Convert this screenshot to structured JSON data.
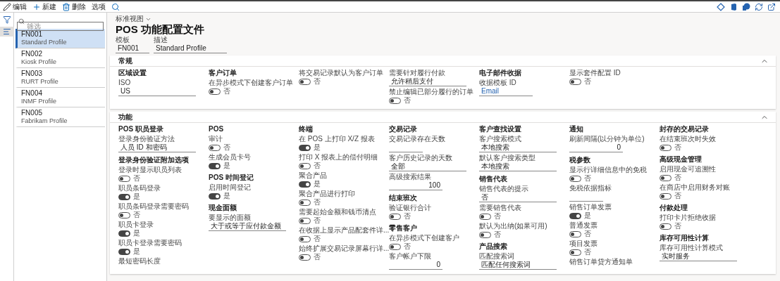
{
  "toolbar": {
    "actions": [
      {
        "label": "编辑",
        "kind": "edit"
      },
      {
        "label": "新建",
        "kind": "new"
      },
      {
        "label": "删除",
        "kind": "delete"
      },
      {
        "label": "选项",
        "kind": "plain"
      }
    ]
  },
  "filter": {
    "placeholder": "筛选"
  },
  "records": [
    {
      "id": "FN001",
      "name": "Standard Profile",
      "selected": true
    },
    {
      "id": "FN002",
      "name": "Kiosk Profile",
      "selected": false
    },
    {
      "id": "FN003",
      "name": "RURT Profile",
      "selected": false
    },
    {
      "id": "FN004",
      "name": "INMF Profile",
      "selected": false
    },
    {
      "id": "FN005",
      "name": "Fabrikam Profile",
      "selected": false
    }
  ],
  "view": {
    "label": "标准视图"
  },
  "title": "POS 功能配置文件",
  "header_fields": [
    {
      "label": "模板",
      "value": "FN001"
    },
    {
      "label": "描述",
      "value": "Standard Profile"
    }
  ],
  "sections": [
    {
      "title": "常规",
      "expanded": true,
      "columns": [
        [
          {
            "title": "区域设置",
            "fields": [
              {
                "kind": "text",
                "label": "ISO",
                "value": "US"
              }
            ]
          }
        ],
        [
          {
            "title": "客户订单",
            "fields": [
              {
                "kind": "toggle",
                "label": "在异步模式下创建客户订单",
                "on": false,
                "state_text": "否"
              }
            ]
          }
        ],
        [
          {
            "fields": [
              {
                "kind": "toggle",
                "label": "将交易记录默认为客户订单",
                "on": false,
                "state_text": "否"
              }
            ]
          }
        ],
        [
          {
            "fields": [
              {
                "kind": "text",
                "label": "需要针对履行付款",
                "value": "允许稍后支付"
              },
              {
                "kind": "toggle",
                "label": "禁止编辑已部分履行的订单",
                "on": false,
                "state_text": "否"
              }
            ]
          }
        ],
        [
          {
            "title": "电子邮件收据",
            "fields": [
              {
                "kind": "link",
                "label": "收据模板 ID",
                "value": "Email"
              }
            ]
          }
        ],
        [
          {
            "fields": [
              {
                "kind": "toggle",
                "label": "显示套件配置 ID",
                "on": false,
                "state_text": "否"
              }
            ]
          }
        ],
        []
      ]
    },
    {
      "title": "功能",
      "expanded": true,
      "columns": [
        [
          {
            "title": "POS 职员登录",
            "fields": [
              {
                "kind": "text",
                "label": "登录身份验证方法",
                "value": "人员 ID 和密码"
              }
            ]
          },
          {
            "title": "登录身份验证附加选项",
            "fields": [
              {
                "kind": "toggle",
                "label": "登录时显示职员列表",
                "on": false,
                "state_text": "否"
              },
              {
                "kind": "toggle",
                "label": "职员条码登录",
                "on": true,
                "state_text": "是"
              },
              {
                "kind": "toggle",
                "label": "职员条码登录需要密码",
                "on": false,
                "state_text": "否"
              },
              {
                "kind": "toggle",
                "label": "职员卡登录",
                "on": true,
                "state_text": "是"
              },
              {
                "kind": "toggle",
                "label": "职员卡登录需要密码",
                "on": true,
                "state_text": "是"
              },
              {
                "kind": "caption",
                "label": "最短密码长度"
              }
            ]
          }
        ],
        [
          {
            "title": "POS",
            "fields": [
              {
                "kind": "toggle",
                "label": "审计",
                "on": false,
                "state_text": "否"
              },
              {
                "kind": "toggle",
                "label": "生成会员卡号",
                "on": true,
                "state_text": "是"
              }
            ]
          },
          {
            "title": "POS 时间登记",
            "fields": [
              {
                "kind": "toggle",
                "label": "启用时间登记",
                "on": true,
                "state_text": "是"
              }
            ]
          },
          {
            "title": "现金面额",
            "fields": [
              {
                "kind": "text",
                "label": "要显示的面额",
                "value": "大于或等于应付款金额"
              }
            ]
          }
        ],
        [
          {
            "title": "终端",
            "fields": [
              {
                "kind": "toggle",
                "label": "在 POS 上打印 X/Z 报表",
                "on": true,
                "state_text": "是"
              },
              {
                "kind": "toggle",
                "label": "打印 X 报表上的偿付明细",
                "on": false,
                "state_text": "否"
              },
              {
                "kind": "toggle",
                "label": "聚合产品",
                "on": true,
                "state_text": "是"
              },
              {
                "kind": "toggle",
                "label": "聚合产品进行打印",
                "on": false,
                "state_text": "否"
              },
              {
                "kind": "toggle",
                "label": "需要起始金额和钱币清点",
                "on": false,
                "state_text": "否"
              },
              {
                "kind": "toggle",
                "label": "在收据上显示产品配套件详...",
                "on": false,
                "state_text": "否"
              },
              {
                "kind": "toggle",
                "label": "始终扩展交易记录屏幕行详...",
                "on": false,
                "state_text": "否"
              }
            ]
          }
        ],
        [
          {
            "title": "交易记录",
            "fields": [
              {
                "kind": "empty",
                "label": "交易记录存在天数"
              },
              {
                "kind": "text",
                "label": "客户历史记录的天数",
                "value": "全部"
              },
              {
                "kind": "number",
                "label": "高级搜索结果",
                "value": "100"
              }
            ]
          },
          {
            "title": "结束班次",
            "fields": [
              {
                "kind": "toggle",
                "label": "验证银行合计",
                "on": false,
                "state_text": "否"
              }
            ]
          },
          {
            "title": "零售客户",
            "fields": [
              {
                "kind": "toggle",
                "label": "在异步模式下创建客户",
                "on": false,
                "state_text": "否"
              },
              {
                "kind": "number",
                "label": "客户帐户下限",
                "value": "0"
              }
            ]
          }
        ],
        [
          {
            "title": "客户查找设置",
            "fields": [
              {
                "kind": "text",
                "label": "客户搜索模式",
                "value": "本地搜索"
              },
              {
                "kind": "text",
                "label": "默认客户搜索类型",
                "value": "本地搜索"
              }
            ]
          },
          {
            "title": "销售代表",
            "fields": [
              {
                "kind": "text",
                "label": "销售代表的提示",
                "value": "否"
              },
              {
                "kind": "toggle",
                "label": "需要销售代表",
                "on": false,
                "state_text": "否"
              },
              {
                "kind": "toggle",
                "label": "默认为出纳(如果可用)",
                "on": false,
                "state_text": "否"
              }
            ]
          },
          {
            "title": "产品搜索",
            "fields": [
              {
                "kind": "text",
                "label": "匹配搜索词",
                "value": "匹配任何搜索词"
              }
            ]
          }
        ],
        [
          {
            "title": "通知",
            "fields": [
              {
                "kind": "number",
                "label": "刷新间隔(以分钟为单位)",
                "value": "0"
              }
            ]
          },
          {
            "title": "税参数",
            "fields": [
              {
                "kind": "toggle",
                "label": "显示行详细信息中的免税",
                "on": false,
                "state_text": "否"
              },
              {
                "kind": "empty",
                "label": "免税依据指标"
              },
              {
                "kind": "toggle",
                "label": "销售订单发票",
                "on": true,
                "state_text": "是"
              },
              {
                "kind": "toggle",
                "label": "普通发票",
                "on": false,
                "state_text": "否"
              },
              {
                "kind": "toggle",
                "label": "项目发票",
                "on": false,
                "state_text": "否"
              },
              {
                "kind": "caption",
                "label": "销售订单贷方通知单"
              }
            ]
          }
        ],
        [
          {
            "title": "封存的交易记录",
            "fields": [
              {
                "kind": "toggle",
                "label": "在结束班次时失效",
                "on": false,
                "state_text": "否"
              }
            ]
          },
          {
            "title": "高级现金管理",
            "fields": [
              {
                "kind": "toggle",
                "label": "启用现金可追溯性",
                "on": false,
                "state_text": "否"
              },
              {
                "kind": "toggle",
                "label": "在商店中启用财务对账",
                "on": false,
                "state_text": "否"
              }
            ]
          },
          {
            "title": "付款处理",
            "fields": [
              {
                "kind": "toggle",
                "label": "打印卡片拒绝收据",
                "on": false,
                "state_text": "否"
              }
            ]
          },
          {
            "title": "库存可用性计算",
            "fields": [
              {
                "kind": "text",
                "label": "库存可用性计算模式",
                "value": "实时服务"
              }
            ]
          }
        ]
      ]
    }
  ]
}
